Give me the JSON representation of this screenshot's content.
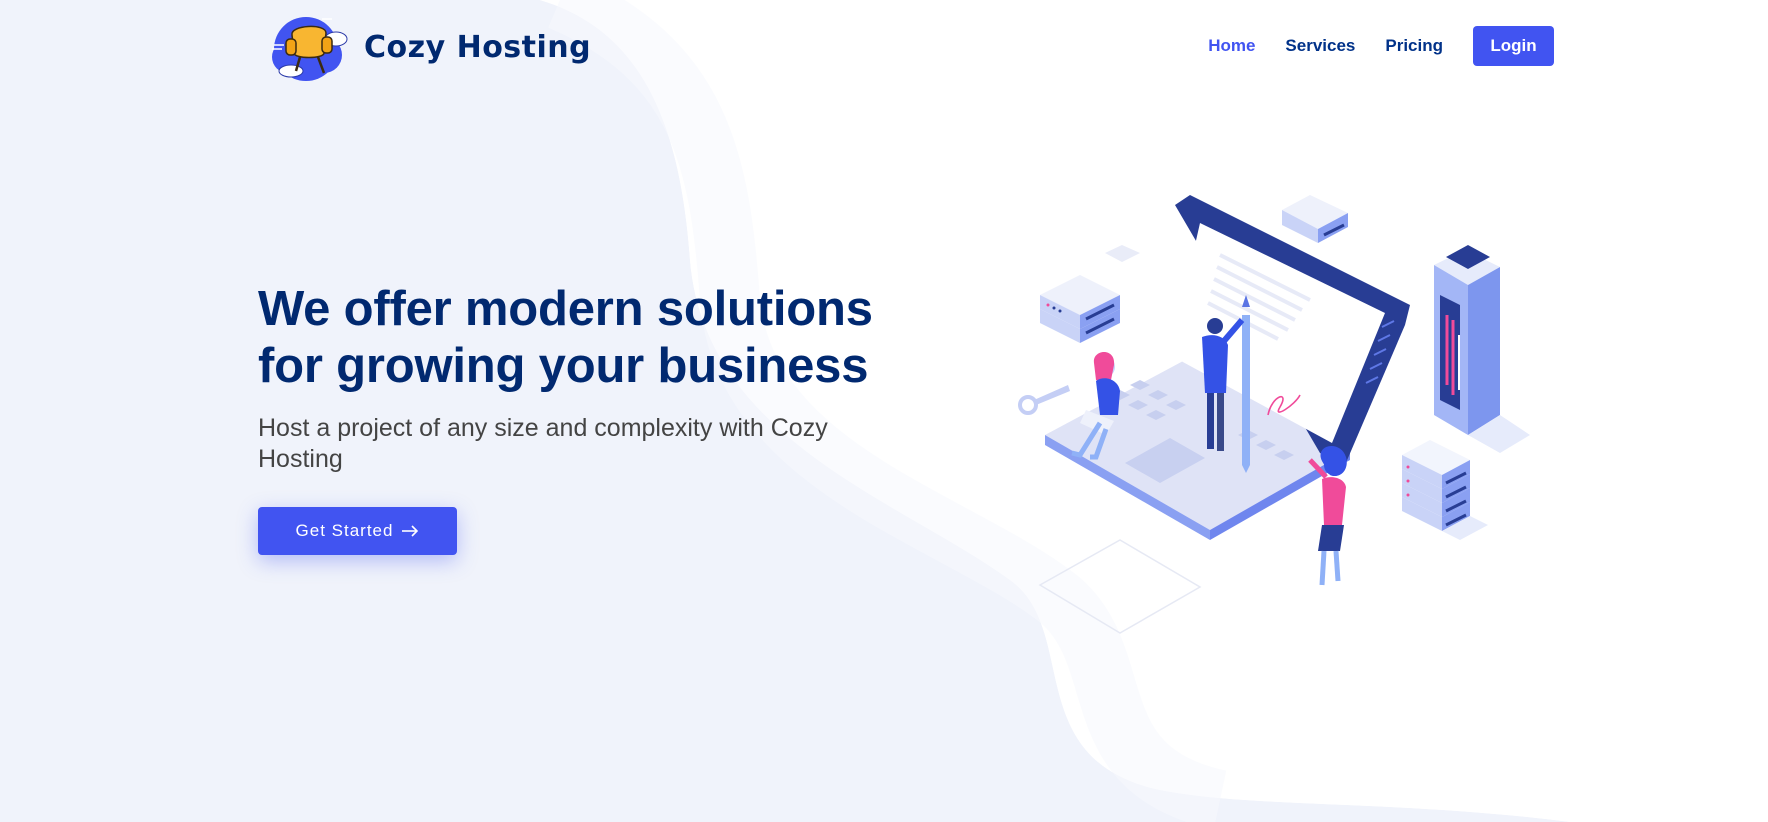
{
  "header": {
    "logo_text": "Cozy Hosting",
    "nav": {
      "home": "Home",
      "services": "Services",
      "pricing": "Pricing",
      "login": "Login"
    }
  },
  "hero": {
    "title": "We offer modern solutions for growing your business",
    "subtitle": "Host a project of any size and complexity with Cozy Hosting",
    "cta": "Get Started",
    "cta_icon": "arrow-right-icon",
    "illustration_icon": "hosting-illustration-icon"
  },
  "colors": {
    "primary": "#4154f1",
    "heading": "#012970",
    "nav_text": "#013289",
    "body_text": "#444444",
    "hero_bg": "#f0f3fb",
    "accent_pink": "#f04b9a"
  }
}
